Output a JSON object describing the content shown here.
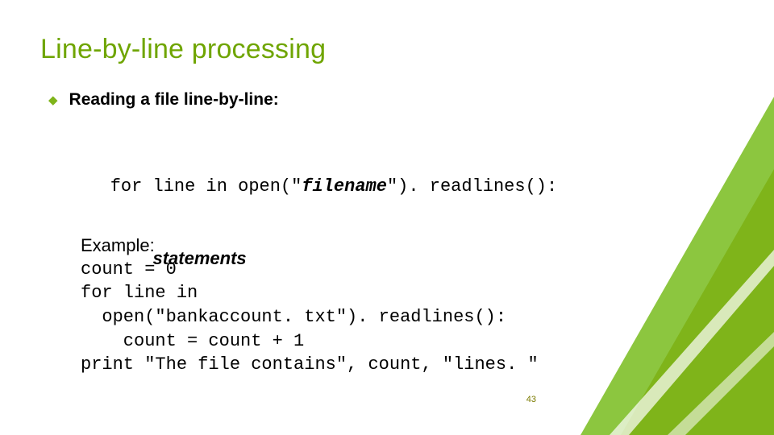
{
  "title": "Line-by-line processing",
  "bullet": {
    "text": "Reading a file line-by-line:"
  },
  "syntax": {
    "l1_pre": "for line in open(\"",
    "l1_fname": "filename",
    "l1_post": "\"). readlines(): ",
    "l2": "statements"
  },
  "example": {
    "label": "Example:",
    "l1": "count = 0",
    "l2": "for line in",
    "l3": "  open(\"bankaccount. txt\"). readlines():",
    "l4": "    count = count + 1",
    "l5": "print \"The file contains\", count, \"lines. \""
  },
  "page_number": "43"
}
